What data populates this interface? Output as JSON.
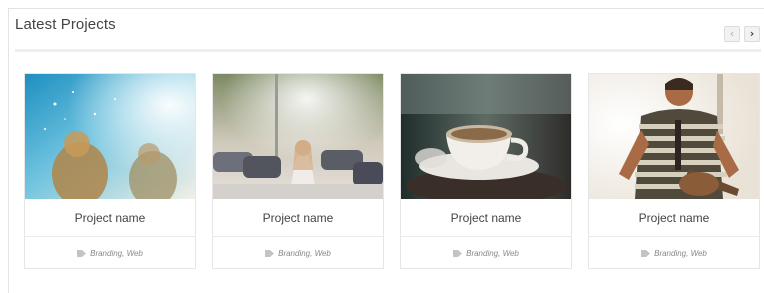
{
  "section": {
    "title": "Latest Projects",
    "nav": {
      "prev_icon": "‹",
      "next_icon": "›"
    }
  },
  "projects": [
    {
      "name": "Project name",
      "tags": "Branding, Web",
      "thumbnail": "people-sparkle-photo"
    },
    {
      "name": "Project name",
      "tags": "Branding, Web",
      "thumbnail": "parking-lot-woman-photo"
    },
    {
      "name": "Project name",
      "tags": "Branding, Web",
      "thumbnail": "coffee-cup-photo"
    },
    {
      "name": "Project name",
      "tags": "Branding, Web",
      "thumbnail": "guitarist-photo"
    }
  ],
  "colors": {
    "title": "#444444",
    "rule": "#eeeeee",
    "card_border": "#e6e6e6",
    "tag_text": "#888888"
  }
}
